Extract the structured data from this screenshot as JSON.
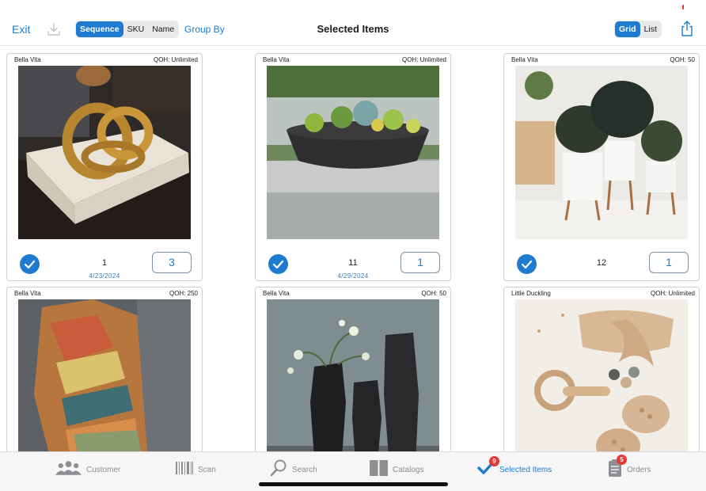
{
  "toolbar": {
    "exit_label": "Exit",
    "sort_options": [
      "Sequence",
      "SKU",
      "Name"
    ],
    "sort_selected": "Sequence",
    "group_by_label": "Group By",
    "title": "Selected Items",
    "view_options": [
      "Grid",
      "List"
    ],
    "view_selected": "Grid"
  },
  "items": [
    {
      "vendor": "Bella Vita",
      "qoh": "QOH: Unlimited",
      "sequence": "1",
      "date": "4/23/2024",
      "quantity": "3",
      "selected": true,
      "image": "gold knot sculpture on book"
    },
    {
      "vendor": "Bella Vita",
      "qoh": "QOH: Unlimited",
      "sequence": "11",
      "date": "4/29/2024",
      "quantity": "1",
      "selected": true,
      "image": "succulent bowl planter"
    },
    {
      "vendor": "Bella Vita",
      "qoh": "QOH: 50",
      "sequence": "12",
      "date": "",
      "quantity": "1",
      "selected": true,
      "image": "potted plants on stands"
    },
    {
      "vendor": "Bella Vita",
      "qoh": "QOH: 250",
      "image": "striped throw blanket on chair"
    },
    {
      "vendor": "Bella Vita",
      "qoh": "QOH: 50",
      "image": "black vases with flowers"
    },
    {
      "vendor": "Little Duckling",
      "qoh": "QOH: Unlimited",
      "image": "baby headband, rattle and shoes"
    }
  ],
  "tabbar": {
    "tabs": [
      {
        "label": "Customer",
        "icon": "people-icon"
      },
      {
        "label": "Scan",
        "icon": "barcode-icon"
      },
      {
        "label": "Search",
        "icon": "magnifier-icon"
      },
      {
        "label": "Catalogs",
        "icon": "book-icon"
      },
      {
        "label": "Selected Items",
        "icon": "checkmark-icon",
        "badge": "9",
        "active": true
      },
      {
        "label": "Orders",
        "icon": "clipboard-icon",
        "badge": "5"
      }
    ]
  },
  "colors": {
    "accent": "#1f7bd0",
    "badge": "#e53935"
  }
}
